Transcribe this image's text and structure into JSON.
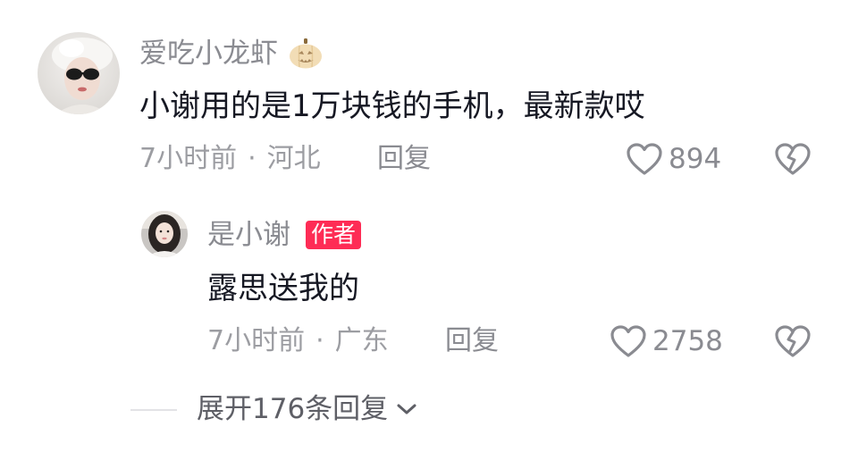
{
  "comment": {
    "username": "爱吃小龙虾",
    "username_emoji": "pumpkin-emoji-icon",
    "text": "小谢用的是1万块钱的手机，最新款哎",
    "time": "7小时前",
    "location": "河北",
    "separator": "·",
    "reply_label": "回复",
    "likes": "894"
  },
  "reply": {
    "username": "是小谢",
    "badge": "作者",
    "text": "露思送我的",
    "time": "7小时前",
    "location": "广东",
    "separator": "·",
    "reply_label": "回复",
    "likes": "2758"
  },
  "expand_label": "展开176条回复",
  "colors": {
    "badge_bg": "#fe2c55",
    "primary_text": "#161823",
    "secondary_text": "#8a8b91"
  }
}
